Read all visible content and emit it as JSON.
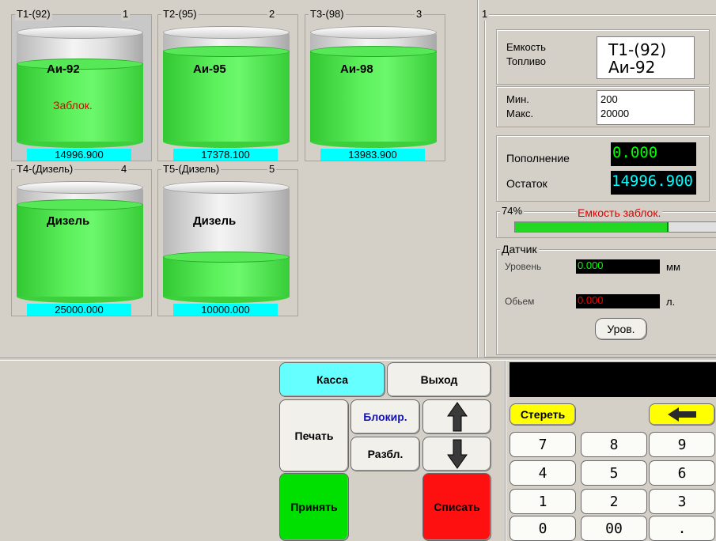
{
  "tanks": [
    {
      "title": "T1-(92)",
      "num": "1",
      "fuel": "Аи-92",
      "status": "Заблок.",
      "volume": "14996.900",
      "level": 0.74
    },
    {
      "title": "T2-(95)",
      "num": "2",
      "fuel": "Аи-95",
      "status": "",
      "volume": "17378.100",
      "level": 0.86
    },
    {
      "title": "T3-(98)",
      "num": "3",
      "fuel": "Аи-98",
      "status": "",
      "volume": "13983.900",
      "level": 0.86
    },
    {
      "title": "T4-(Дизель)",
      "num": "4",
      "fuel": "Дизель",
      "status": "",
      "volume": "25000.000",
      "level": 0.88
    },
    {
      "title": "T5-(Дизель)",
      "num": "5",
      "fuel": "Дизель",
      "status": "",
      "volume": "10000.000",
      "level": 0.38
    }
  ],
  "panel": {
    "num": "1",
    "tank_label": "Емкость",
    "fuel_label": "Топливо",
    "tank_value": "T1-(92)",
    "fuel_value": "Аи-92",
    "min_label": "Мин.",
    "max_label": "Макс.",
    "min_value": "200",
    "max_value": "20000",
    "refill_label": "Пополнение",
    "remain_label": "Остаток",
    "refill_value": "0.000",
    "remain_value": "14996.900",
    "percent": "74%",
    "percent_value": 0.74,
    "locked_text": "Емкость заблок.",
    "sensor_title": "Датчик",
    "level_label": "Уровень",
    "level_value": "0.000",
    "level_unit": "мм",
    "volume_label": "Обьем",
    "volume_value": "0.000",
    "volume_unit": "л.",
    "level_button": "Уров."
  },
  "buttons": {
    "kassa": "Касса",
    "exit": "Выход",
    "print": "Печать",
    "block": "Блокир.",
    "unblock": "Разбл.",
    "accept": "Принять",
    "writeoff": "Списать"
  },
  "keypad": {
    "display": "",
    "clear": "Стереть",
    "keys": [
      "7",
      "8",
      "9",
      "4",
      "5",
      "6",
      "1",
      "2",
      "3",
      "0",
      "00",
      "."
    ]
  },
  "colors": {
    "liquid": "#4ce44c",
    "volume_bg": "#00ffff",
    "kassa": "#66ffff",
    "accept": "#00e000",
    "writeoff": "#ff1010",
    "clear": "#ffff00",
    "lcd_green": "#00ff00",
    "lcd_cyan": "#00ffff",
    "lcd_red": "#ff0000",
    "blocked_red": "#e00000"
  },
  "icons": {
    "up": "arrow-up-icon",
    "down": "arrow-down-icon",
    "back": "arrow-left-icon"
  }
}
